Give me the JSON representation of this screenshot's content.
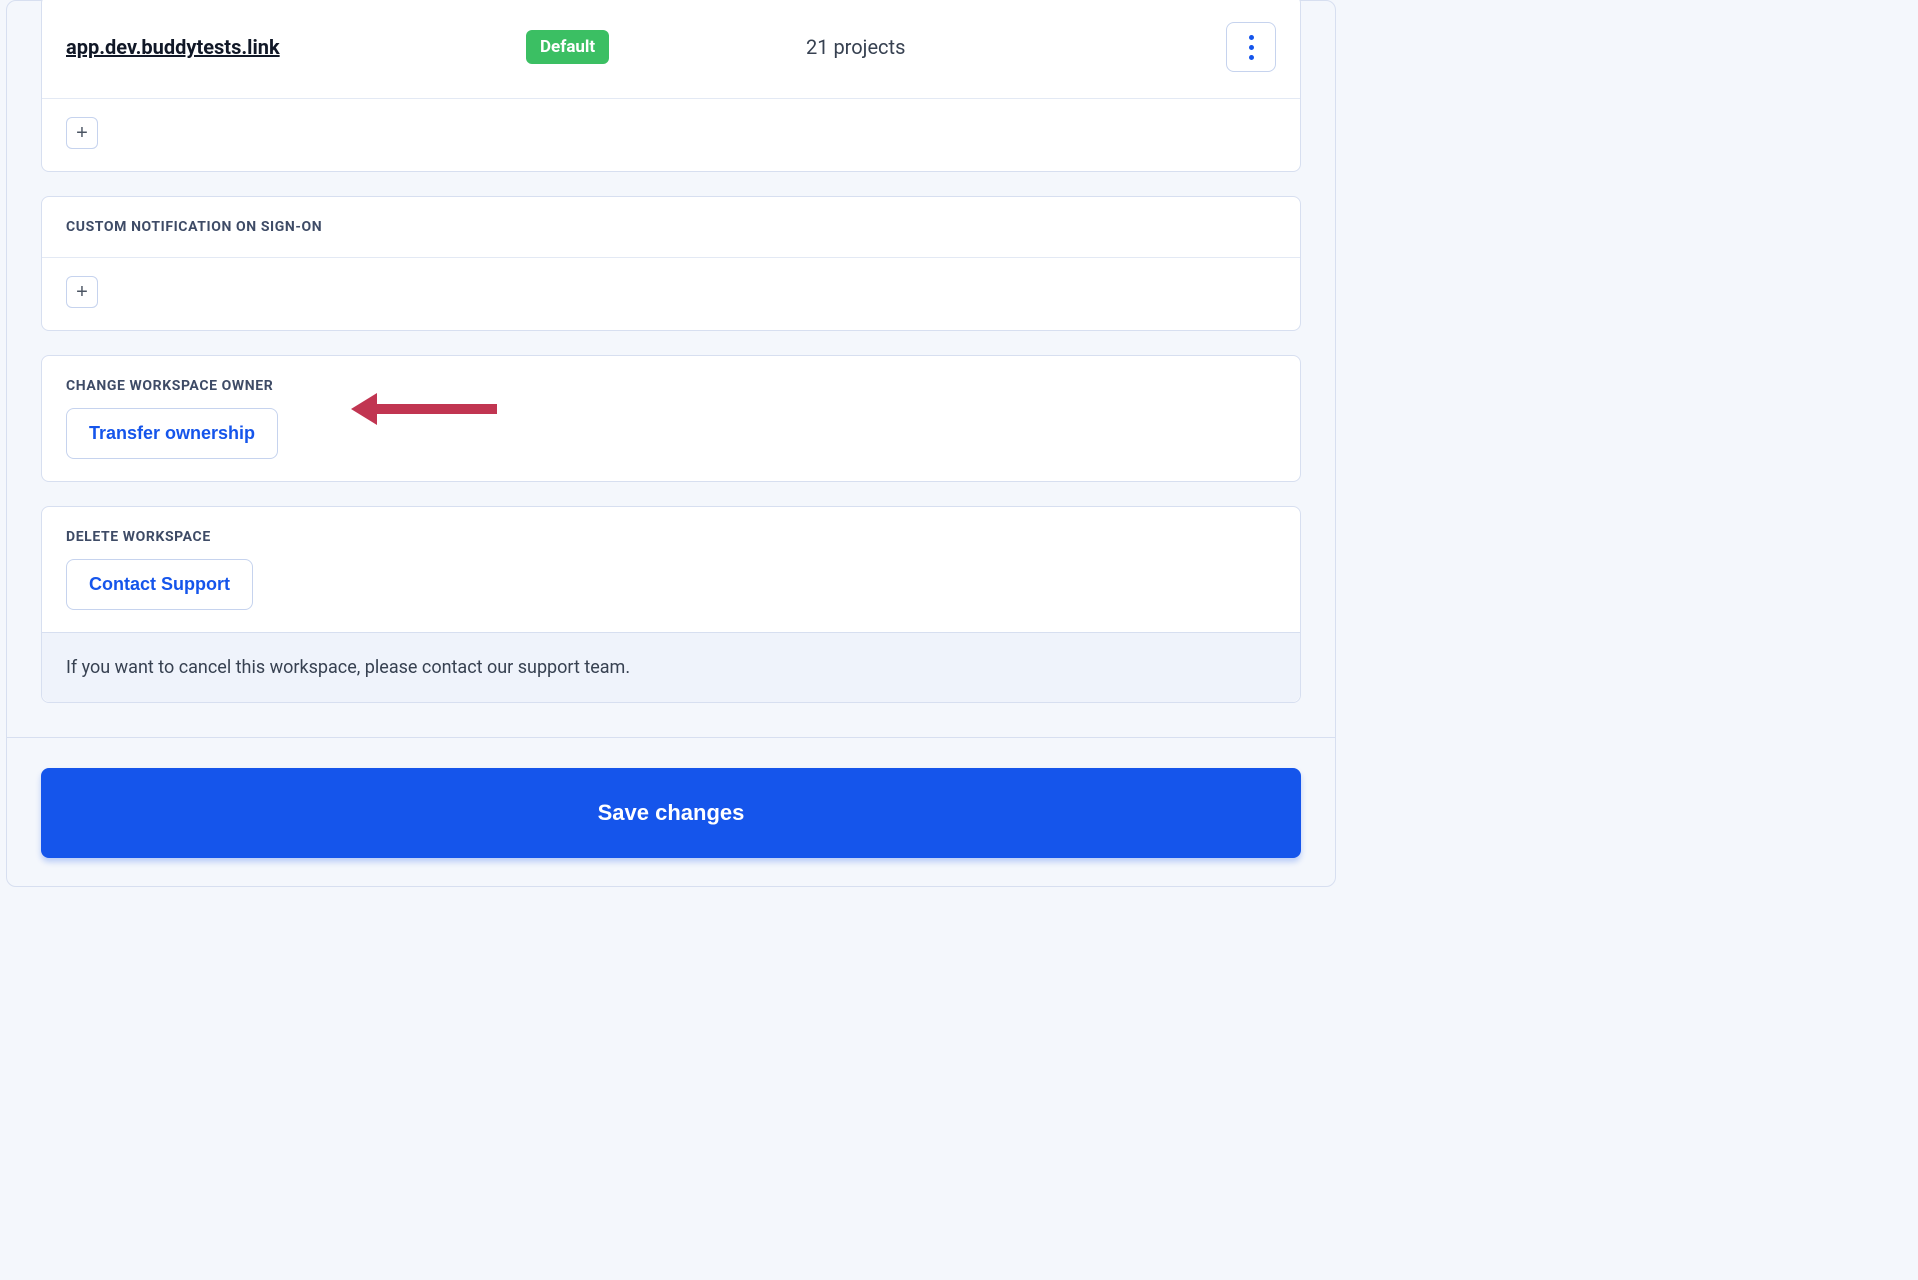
{
  "domains": {
    "row": {
      "name": "app.dev.buddytests.link",
      "badge": "Default",
      "projects": "21 projects"
    }
  },
  "notifications": {
    "header": "CUSTOM NOTIFICATION ON SIGN-ON"
  },
  "owner": {
    "header": "CHANGE WORKSPACE OWNER",
    "transfer_label": "Transfer ownership"
  },
  "delete": {
    "header": "DELETE WORKSPACE",
    "contact_label": "Contact Support",
    "footer_text": "If you want to cancel this workspace, please contact our support team."
  },
  "save": {
    "label": "Save changes"
  },
  "colors": {
    "accent": "#1555eb",
    "success": "#3bbf63",
    "annotation": "#c13551"
  }
}
